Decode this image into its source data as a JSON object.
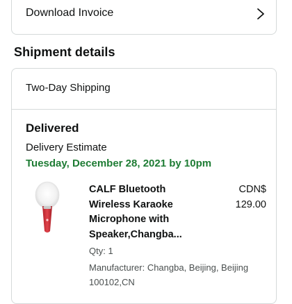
{
  "invoice": {
    "label": "Download Invoice",
    "chevron_icon": "chevron-right-icon"
  },
  "shipment": {
    "section_title": "Shipment details",
    "shipping_method": "Two-Day Shipping",
    "status": "Delivered",
    "estimate_label": "Delivery Estimate",
    "estimate_date": "Tuesday, December 28, 2021 by 10pm",
    "estimate_color": "#1e7c34",
    "item": {
      "thumbnail_icon": "karaoke-microphone-image",
      "title": "CALF Bluetooth Wireless Karaoke Microphone with Speaker,Changba...",
      "price_currency": "CDN$",
      "price_amount": "129.00",
      "qty": "Qty: 1",
      "manufacturer": "Manufacturer: Changba, Beijing, Beijing 100102,CN"
    }
  }
}
